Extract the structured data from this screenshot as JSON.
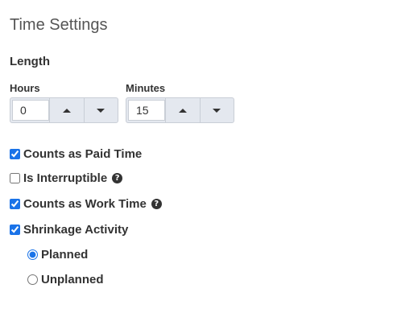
{
  "section_title": "Time Settings",
  "length_label": "Length",
  "hours": {
    "label": "Hours",
    "value": "0"
  },
  "minutes": {
    "label": "Minutes",
    "value": "15"
  },
  "options": {
    "counts_paid_time": {
      "label": "Counts as Paid Time",
      "checked": true
    },
    "is_interruptible": {
      "label": "Is Interruptible",
      "checked": false
    },
    "counts_work_time": {
      "label": "Counts as Work Time",
      "checked": true
    },
    "shrinkage_activity": {
      "label": "Shrinkage Activity",
      "checked": true
    }
  },
  "shrinkage_type": {
    "planned": {
      "label": "Planned",
      "selected": true
    },
    "unplanned": {
      "label": "Unplanned",
      "selected": false
    }
  },
  "icons": {
    "help": "question-circle-icon",
    "up": "arrow-up-icon",
    "down": "arrow-down-icon"
  },
  "colors": {
    "accent": "#1a73e8",
    "spinner_bg": "#e4e8ef"
  }
}
